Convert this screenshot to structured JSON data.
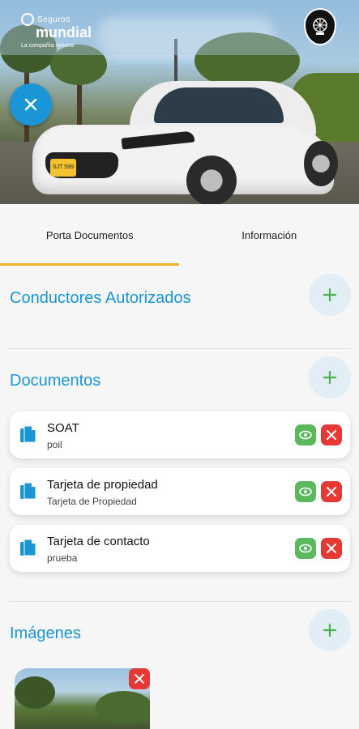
{
  "header": {
    "brand_top": "Seguros",
    "brand_name": "mundial",
    "brand_tagline": "La compañía sincera",
    "plate_text": "SJT 599"
  },
  "tabs": [
    {
      "label": "Porta Documentos",
      "active": true
    },
    {
      "label": "Información",
      "active": false
    }
  ],
  "sections": {
    "drivers": {
      "title": "Conductores Autorizados"
    },
    "documents": {
      "title": "Documentos",
      "items": [
        {
          "title": "SOAT",
          "subtitle": "poil"
        },
        {
          "title": "Tarjeta de propiedad",
          "subtitle": "Tarjeta de Propiedad"
        },
        {
          "title": "Tarjeta de contacto",
          "subtitle": "prueba"
        }
      ]
    },
    "images": {
      "title": "Imágenes"
    }
  },
  "colors": {
    "accent": "#1a96d6",
    "tab_indicator": "#f0b429",
    "view": "#5cb85c",
    "delete": "#e53935",
    "add_bg": "#e2eef6",
    "add_icon": "#4caf50"
  },
  "icons": {
    "close": "close-icon",
    "add": "plus-icon",
    "document": "document-copy-icon",
    "view": "eye-icon",
    "delete": "x-icon"
  }
}
